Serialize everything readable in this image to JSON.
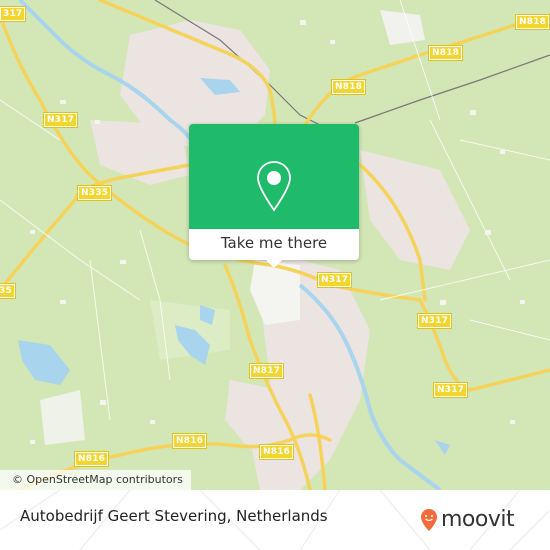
{
  "map": {
    "attribution": "© OpenStreetMap contributors",
    "road_labels": [
      {
        "id": "n317-top-left",
        "text": "317"
      },
      {
        "id": "n317-left",
        "text": "N317"
      },
      {
        "id": "n335",
        "text": "N335"
      },
      {
        "id": "n35-edge",
        "text": "35"
      },
      {
        "id": "n818-a",
        "text": "N818"
      },
      {
        "id": "n818-b",
        "text": "N818"
      },
      {
        "id": "n818-c",
        "text": "N818"
      },
      {
        "id": "n317-center",
        "text": "N317"
      },
      {
        "id": "n317-right-a",
        "text": "N317"
      },
      {
        "id": "n317-right-b",
        "text": "N317"
      },
      {
        "id": "n817",
        "text": "N817"
      },
      {
        "id": "n816-a",
        "text": "N816"
      },
      {
        "id": "n816-b",
        "text": "N816"
      },
      {
        "id": "n816-c",
        "text": "N816"
      }
    ],
    "colors": {
      "land": "#d3e6b6",
      "urban": "#ebe4e0",
      "water": "#a8d4ee",
      "road": "#f5d35a",
      "popup_green": "#1fba6a",
      "moovit_orange": "#f26b3a"
    }
  },
  "popup": {
    "icon": "map-pin-icon",
    "button_label": "Take me there"
  },
  "footer": {
    "place_name": "Autobedrijf Geert Stevering, Netherlands",
    "logo_text": "moovit",
    "logo_icon": "moovit-smile-pin-icon"
  }
}
